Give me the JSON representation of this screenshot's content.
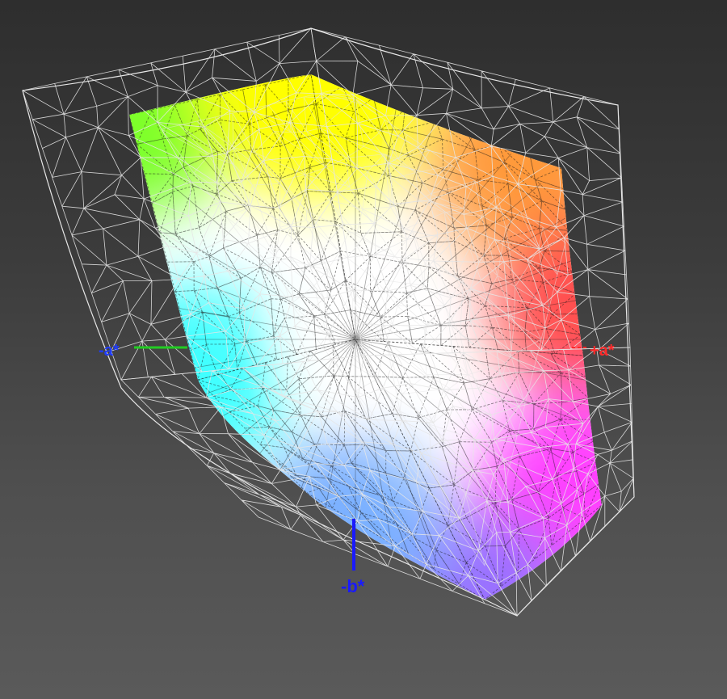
{
  "axes": {
    "neg_a": {
      "label": "-a*",
      "color": "#1f3cff",
      "line_color": "#22cc22"
    },
    "pos_a": {
      "label": "+a*",
      "color": "#ff2a2a"
    },
    "neg_b": {
      "label": "-b*",
      "color": "#1a1aff"
    }
  },
  "colors": {
    "background_top": "#2e2e2e",
    "background_bottom": "#5a5a5a",
    "wireframe": "#e6e6e6",
    "inner_mesh": "#1a1a1a",
    "gamut_green": "#7cff2a",
    "gamut_yellow": "#ffff00",
    "gamut_orange": "#ff9a3a",
    "gamut_red": "#ff5050",
    "gamut_magenta": "#ff40ff",
    "gamut_violet": "#9a70ff",
    "gamut_blue": "#7ab0ff",
    "gamut_cyan": "#40ffff",
    "gamut_white": "#ffffff"
  }
}
